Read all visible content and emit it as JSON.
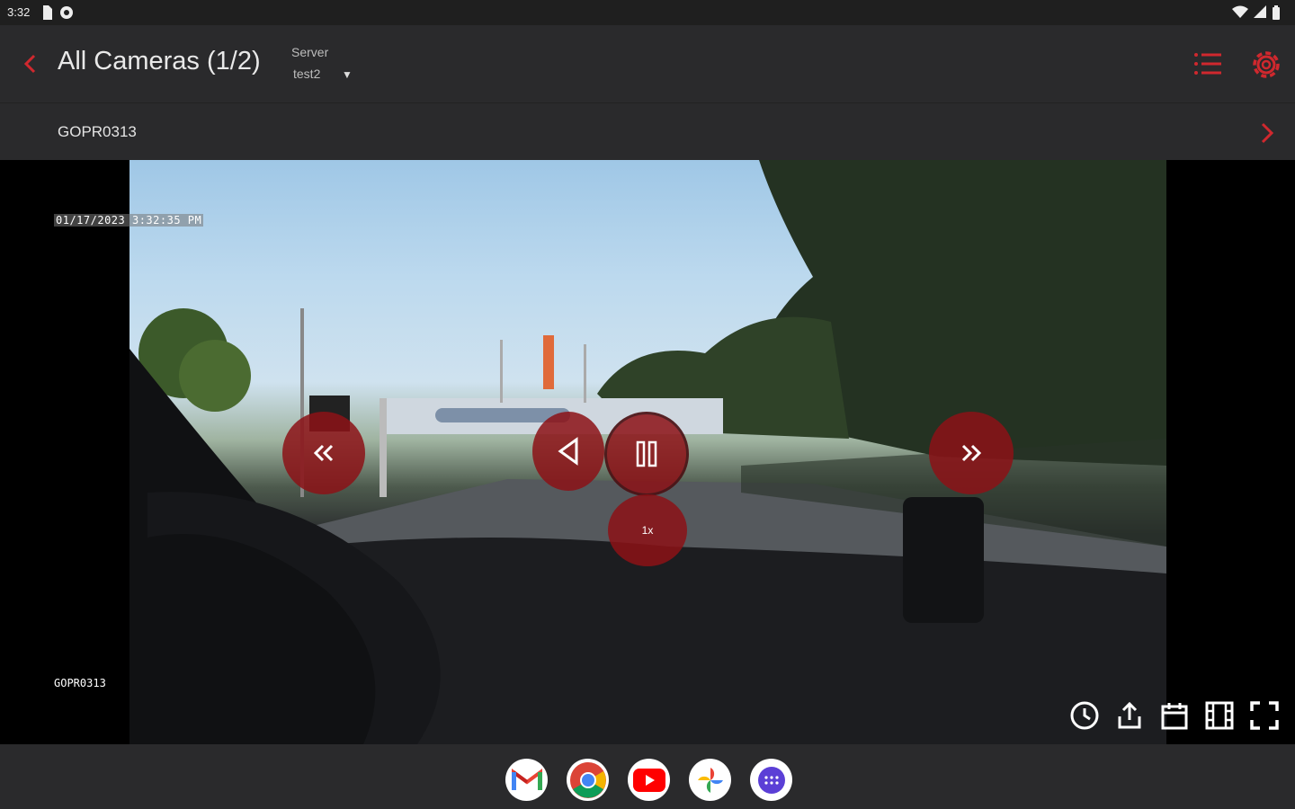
{
  "status": {
    "time": "3:32"
  },
  "appbar": {
    "title": "All Cameras (1/2)",
    "server_label": "Server",
    "server_value": "test2",
    "accent": "#d0282e"
  },
  "camera": {
    "name": "GOPR0313"
  },
  "video": {
    "overlay_datetime": "01/17/2023 3:32:35 PM",
    "overlay_camera": "GOPR0313",
    "speed": "1x"
  },
  "icons": {
    "back": "chevron-left-icon",
    "list": "list-icon",
    "settings": "gear-icon",
    "next": "chevron-right-icon",
    "rewind": "double-chevron-left-icon",
    "reverse": "play-reverse-icon",
    "pause": "pause-icon",
    "forward": "double-chevron-right-icon",
    "history": "clock-icon",
    "share": "share-icon",
    "calendar": "calendar-icon",
    "film": "film-icon",
    "fullscreen": "fullscreen-icon"
  },
  "dock": {
    "apps": [
      "gmail",
      "chrome",
      "youtube",
      "photos",
      "app-drawer"
    ]
  }
}
